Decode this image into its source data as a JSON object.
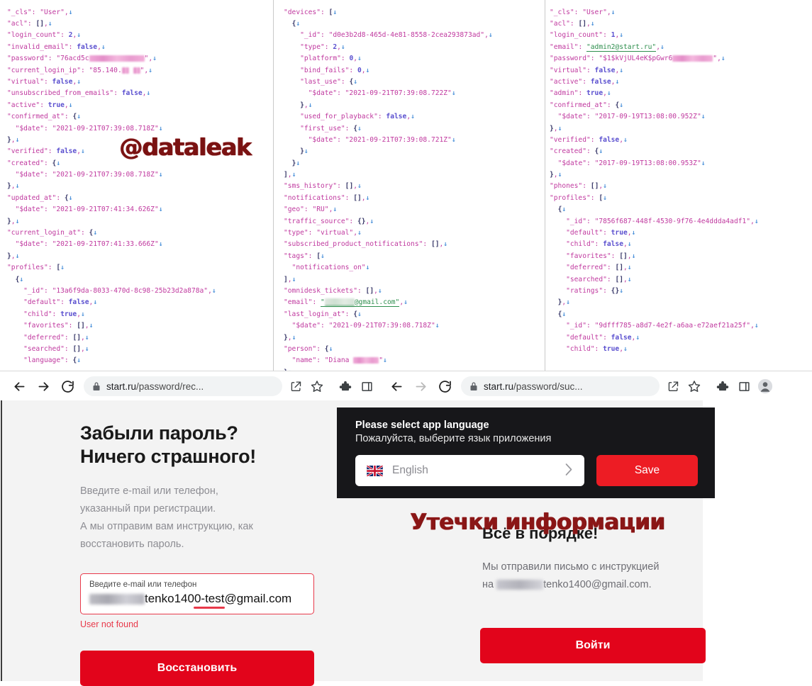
{
  "json_dump": {
    "column1_lines": [
      "\"_cls\": \"User\",",
      "\"acl\": [],",
      "\"login_count\": 2,",
      "\"invalid_email\": false,",
      "\"password\": \"76acd5c███████████████\",",
      "\"current_login_ip\": \"85.140.██ ██\",",
      "\"virtual\": false,",
      "\"unsubscribed_from_emails\": false,",
      "\"active\": true,",
      "\"confirmed_at\": {",
      "  \"$date\": \"2021-09-21T07:39:08.718Z\"",
      "},",
      "\"verified\": false,",
      "\"created\": {",
      "  \"$date\": \"2021-09-21T07:39:08.718Z\"",
      "},",
      "\"updated_at\": {",
      "  \"$date\": \"2021-09-21T07:41:34.626Z\"",
      "},",
      "\"current_login_at\": {",
      "  \"$date\": \"2021-09-21T07:41:33.666Z\"",
      "},",
      "\"profiles\": [",
      "  {",
      "    \"_id\": \"13a6f9da-8033-470d-8c98-25b23d2a878a\",",
      "    \"default\": false,",
      "    \"child\": true,",
      "    \"favorites\": [],",
      "    \"deferred\": [],",
      "    \"searched\": [],",
      "    \"language\": {"
    ],
    "column2_lines": [
      "\"devices\": [",
      "  {",
      "    \"_id\": \"d0e3b2d8-465d-4e81-8558-2cea293873ad\",",
      "    \"type\": 2,",
      "    \"platform\": 0,",
      "    \"bind_fails\": 0,",
      "    \"last_use\": {",
      "      \"$date\": \"2021-09-21T07:39:08.722Z\"",
      "    },",
      "    \"used_for_playback\": false,",
      "    \"first_use\": {",
      "      \"$date\": \"2021-09-21T07:39:08.721Z\"",
      "    }",
      "  }",
      "],",
      "\"sms_history\": [],",
      "\"notifications\": [],",
      "\"geo\": \"RU\",",
      "\"traffic_source\": {},",
      "\"type\": \"virtual\",",
      "\"subscribed_product_notifications\": [],",
      "\"tags\": [",
      "  \"notifications_on\"",
      "],",
      "\"omnidesk_tickets\": [],",
      "\"email\": \"████████@gmail.com\",",
      "\"last_login_at\": {",
      "  \"$date\": \"2021-09-21T07:39:08.718Z\"",
      "},",
      "\"person\": {",
      "  \"name\": \"Diana ███████\"",
      "}"
    ],
    "column3_lines": [
      "\"_cls\": \"User\",",
      "\"acl\": [],",
      "\"login_count\": 1,",
      "\"email\": \"admin2@start.ru\",",
      "\"password\": \"$1$kVjUL4eK$pGwr6███████████\",",
      "\"virtual\": false,",
      "\"active\": false,",
      "\"admin\": true,",
      "\"confirmed_at\": {",
      "  \"$date\": \"2017-09-19T13:08:00.952Z\"",
      "},",
      "\"verified\": false,",
      "\"created\": {",
      "  \"$date\": \"2017-09-19T13:08:00.953Z\"",
      "},",
      "\"phones\": [],",
      "\"profiles\": [",
      "  {",
      "    \"_id\": \"7856f687-448f-4530-9f76-4e4ddda4adf1\",",
      "    \"default\": true,",
      "    \"child\": false,",
      "    \"favorites\": [],",
      "    \"deferred\": [],",
      "    \"searched\": [],",
      "    \"ratings\": {}",
      "  },",
      "  {",
      "    \"_id\": \"9dfff785-a8d7-4e2f-a6aa-e72aef21a25f\",",
      "    \"default\": false,",
      "    \"child\": true,"
    ],
    "watermark": "@dataleak"
  },
  "browser": {
    "tab_left": {
      "url_prefix": "start.ru",
      "url_path": "/password/rec...",
      "lock_icon": "lock-icon",
      "back_icon": "back-arrow-icon",
      "forward_icon": "forward-arrow-icon",
      "reload_icon": "reload-icon",
      "share_icon": "share-icon",
      "bookmark_icon": "star-icon",
      "extensions_icon": "puzzle-icon",
      "sidepanel_icon": "side-panel-icon"
    },
    "tab_right": {
      "url_prefix": "start.ru",
      "url_path": "/password/suc...",
      "lock_icon": "lock-icon",
      "back_icon": "back-arrow-icon",
      "forward_icon": "forward-arrow-icon",
      "reload_icon": "reload-icon",
      "share_icon": "share-icon",
      "bookmark_icon": "star-icon",
      "extensions_icon": "puzzle-icon",
      "sidepanel_icon": "side-panel-icon",
      "profile_icon": "account-avatar-icon"
    }
  },
  "recovery_page": {
    "heading_line1": "Забыли пароль?",
    "heading_line2": "Ничего страшного!",
    "lede_line1": "Введите e-mail или телефон,",
    "lede_line2": "указанный при регистрации.",
    "lede_line3": "А мы отправим вам инструкцию, как",
    "lede_line4": "восстановить пароль.",
    "field_label": "Введите e-mail или телефон",
    "field_value": "tenko1400-test@gmail.com",
    "error": "User not found",
    "submit_label": "Восстановить"
  },
  "success_page": {
    "heading": "Всё в порядке!",
    "text_line1": "Мы отправили письмо с инструкцией",
    "text_line2_prefix": "на",
    "text_line2_email": "tenko1400@gmail.com.",
    "login_label": "Войти"
  },
  "language_modal": {
    "title_en": "Please select app language",
    "title_ru": "Пожалуйста, выберите язык приложения",
    "selected_language": "English",
    "flag_icon": "uk-flag-icon",
    "chevron_icon": "chevron-right-icon",
    "save_label": "Save"
  },
  "watermark_ru": "Утечки информации",
  "colors": {
    "accent_red": "#e2041b",
    "modal_red": "#ed1c24",
    "error_red": "#e8394a",
    "modal_bg": "#17171a",
    "page_bg": "#f3f3f3",
    "json_key": "#c0399f",
    "json_value": "#5a4fcf",
    "watermark": "#7a1212"
  }
}
